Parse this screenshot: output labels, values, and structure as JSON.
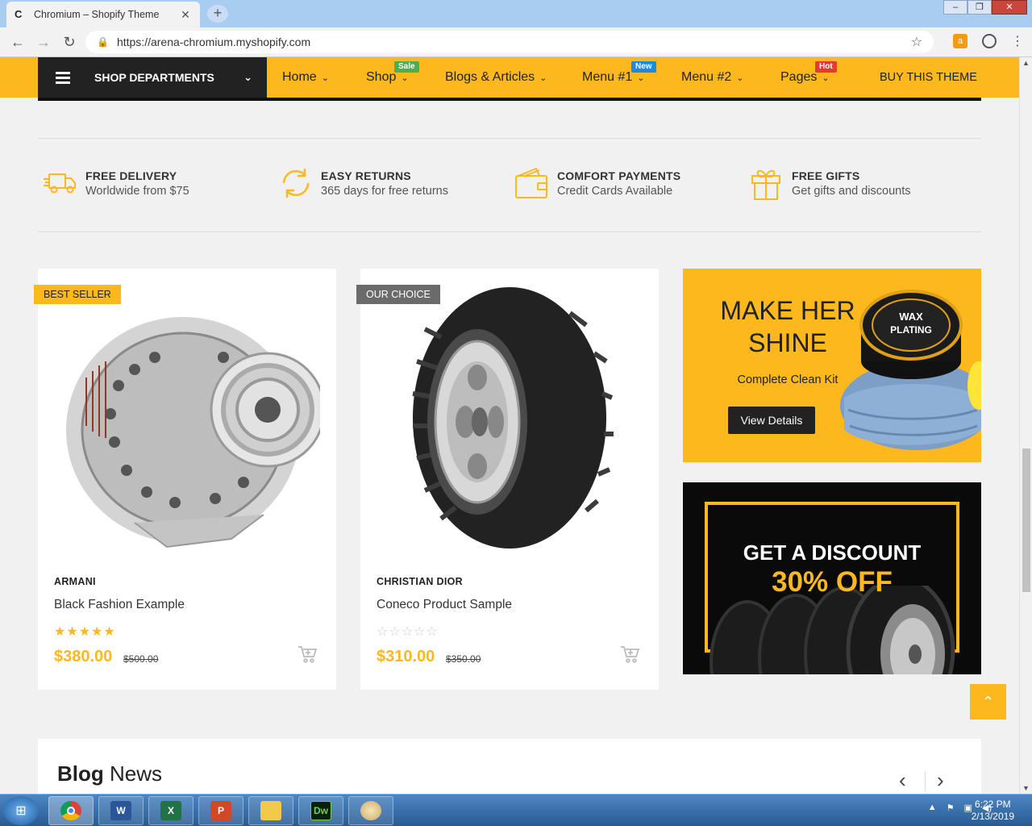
{
  "browser": {
    "tab_title": "Chromium – Shopify Theme",
    "tab_favicon": "C",
    "url": "https://arena-chromium.myshopify.com"
  },
  "nav": {
    "departments": "SHOP DEPARTMENTS",
    "items": [
      {
        "label": "Home"
      },
      {
        "label": "Shop",
        "badge": "Sale",
        "badge_color": "#4caf50"
      },
      {
        "label": "Blogs & Articles"
      },
      {
        "label": "Menu #1",
        "badge": "New",
        "badge_color": "#1e88e5"
      },
      {
        "label": "Menu #2"
      },
      {
        "label": "Pages",
        "badge": "Hot",
        "badge_color": "#e53935"
      }
    ],
    "buy": "BUY THIS THEME"
  },
  "features": [
    {
      "title": "FREE DELIVERY",
      "sub": "Worldwide from $75",
      "icon": "truck-icon"
    },
    {
      "title": "EASY RETURNS",
      "sub": "365 days for free returns",
      "icon": "refresh-icon"
    },
    {
      "title": "COMFORT PAYMENTS",
      "sub": "Credit Cards Available",
      "icon": "wallet-icon"
    },
    {
      "title": "FREE GIFTS",
      "sub": "Get gifts and discounts",
      "icon": "gift-icon"
    }
  ],
  "products": [
    {
      "label": "BEST SELLER",
      "brand": "ARMANI",
      "name": "Black Fashion Example",
      "rating": 5,
      "price": "$380.00",
      "old_price": "$500.00"
    },
    {
      "label": "OUR CHOICE",
      "brand": "CHRISTIAN DIOR",
      "name": "Coneco Product Sample",
      "rating": 0,
      "price": "$310.00",
      "old_price": "$350.00"
    }
  ],
  "promo1": {
    "line1": "MAKE HER",
    "line2": "SHINE",
    "sub": "Complete Clean Kit",
    "button": "View Details",
    "product_text_1": "WAX",
    "product_text_2": "PLATING"
  },
  "promo2": {
    "line1": "GET A DISCOUNT",
    "line2": "30% OFF"
  },
  "blog": {
    "title_bold": "Blog",
    "title_rest": " News"
  },
  "taskbar": {
    "time": "6:22 PM",
    "date": "2/13/2019"
  },
  "colors": {
    "accent": "#fdb81e",
    "dark": "#222222"
  }
}
